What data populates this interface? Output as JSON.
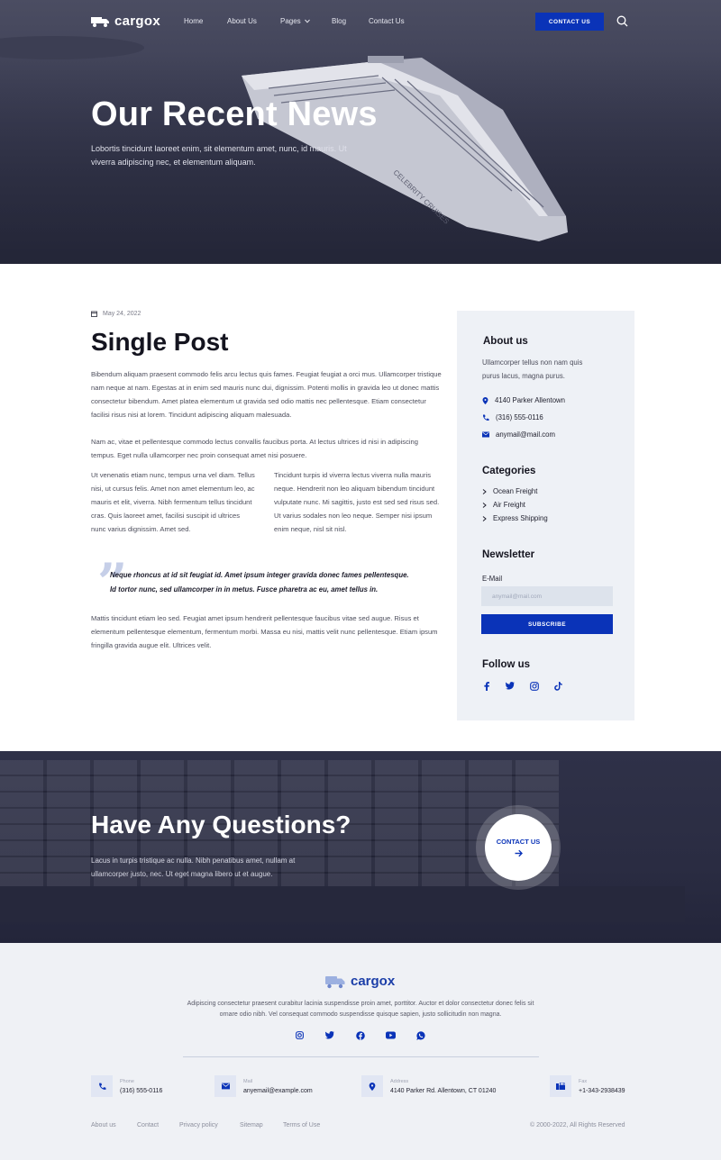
{
  "nav": {
    "brand": "cargox",
    "links": [
      "Home",
      "About Us",
      "Pages",
      "Blog",
      "Contact Us"
    ],
    "cta": "CONTACT US"
  },
  "hero": {
    "title": "Our Recent News",
    "subtitle": "Lobortis tincidunt laoreet enim, sit elementum amet, nunc, id mauris. Ut viverra adipiscing nec, et elementum aliquam.",
    "ship_name": "CELEBRITY CRUISES"
  },
  "post": {
    "date": "May 24, 2022",
    "title": "Single Post",
    "para1": "Bibendum aliquam praesent commodo felis arcu lectus quis fames. Feugiat feugiat a orci mus. Ullamcorper tristique nam neque at nam. Egestas at in enim sed mauris nunc dui, dignissim. Potenti mollis in gravida leo ut donec mattis consectetur bibendum. Amet platea elementum ut gravida sed odio mattis nec pellentesque. Etiam consectetur facilisi risus nisi at lorem. Tincidunt adipiscing aliquam malesuada.",
    "para2": "Nam ac, vitae et pellentesque commodo lectus convallis faucibus porta. At lectus ultrices id nisi in adipiscing tempus. Eget nulla ullamcorper nec proin consequat amet nisi posuere.",
    "col_left": "Ut venenatis etiam nunc, tempus urna vel diam. Tellus nisi, ut cursus felis. Amet non amet elementum leo, ac mauris et elit, viverra. Nibh fermentum tellus tincidunt cras. Quis laoreet amet, facilisi suscipit id ultrices nunc varius dignissim. Amet sed.",
    "col_right": "Tincidunt turpis id viverra lectus viverra nulla mauris neque. Hendrerit non leo aliquam bibendum tincidunt vulputate nunc. Mi sagittis, justo est sed sed risus sed. Ut varius sodales non leo neque. Semper nisi ipsum enim neque, nisl sit nisl.",
    "quote": "Neque rhoncus at id sit feugiat id. Amet ipsum integer gravida donec fames pellentesque. Id tortor nunc, sed ullamcorper in in metus. Fusce pharetra ac eu, amet tellus in.",
    "para3": "Mattis tincidunt etiam leo sed. Feugiat amet ipsum hendrerit pellentesque faucibus vitae sed augue. Risus et elementum pellentesque elementum, fermentum morbi. Massa eu nisi, mattis velit nunc pellentesque. Etiam ipsum fringilla gravida augue elit. Ultrices velit."
  },
  "sidebar": {
    "about_title": "About us",
    "about_text": "Ullamcorper tellus non nam quis purus lacus, magna purus.",
    "address": "4140 Parker Allentown",
    "phone": "(316) 555-0116",
    "email": "anymail@mail.com",
    "categories_title": "Categories",
    "categories": [
      "Ocean Freight",
      "Air Freight",
      "Express Shipping"
    ],
    "newsletter_title": "Newsletter",
    "email_label": "E-Mail",
    "email_placeholder": "anymail@mail.com",
    "subscribe": "SUBSCRIBE",
    "follow_title": "Follow us"
  },
  "questions": {
    "title": "Have Any Questions?",
    "text": "Lacus in turpis tristique ac nulla. Nibh penatibus amet, nullam at ullamcorper justo, nec. Ut eget magna libero ut et augue.",
    "cta": "CONTACT US"
  },
  "footer": {
    "brand": "cargox",
    "description": "Adipiscing consectetur praesent curabitur lacinia suspendisse proin amet, porttitor. Auctor et dolor consectetur donec felis sit ornare odio nibh. Vel consequat commodo suspendisse quisque sapien, justo sollicitudin non magna.",
    "contacts": [
      {
        "label": "Phone",
        "value": "(316) 555-0116"
      },
      {
        "label": "Mail",
        "value": "anyemail@example.com"
      },
      {
        "label": "Address",
        "value": "4140 Parker Rd. Allentown, CT 01240"
      },
      {
        "label": "Fax",
        "value": "+1-343-2938439"
      }
    ],
    "links": [
      "About us",
      "Contact",
      "Privacy policy",
      "Sitemap",
      "Terms of Use"
    ],
    "copyright": "© 2000-2022, All Rights Reserved"
  },
  "colors": {
    "accent": "#0a33b8",
    "hero_overlay": "#3a3c52",
    "sidebar_bg": "#eef1f6",
    "footer_bg": "#eff1f5"
  }
}
